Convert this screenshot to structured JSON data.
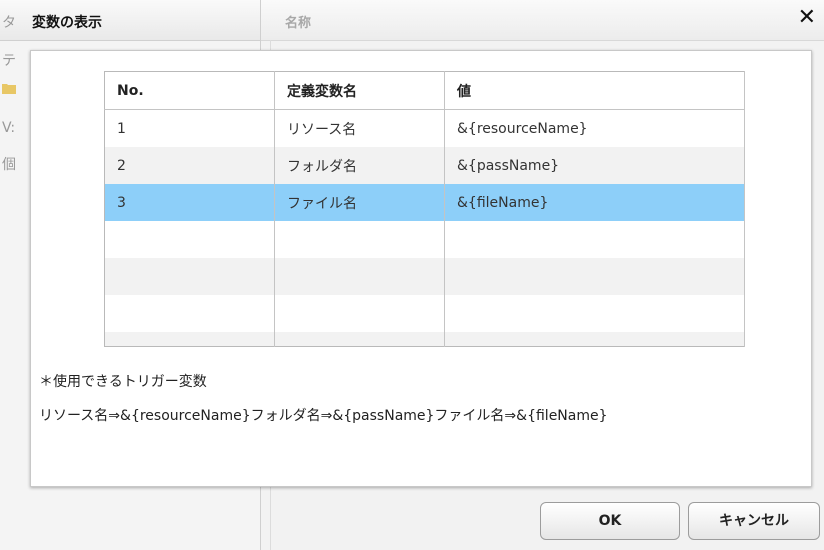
{
  "background": {
    "left_rows": [
      "テ",
      "",
      "V:",
      "個"
    ],
    "left_partial_title": "タ",
    "right_column_header": "名称"
  },
  "dialog": {
    "title": "変数の表示",
    "close_glyph": "✕",
    "table": {
      "headers": [
        "No.",
        "定義変数名",
        "値"
      ],
      "rows": [
        {
          "no": "1",
          "name": "リソース名",
          "value": "&{resourceName}"
        },
        {
          "no": "2",
          "name": "フォルダ名",
          "value": "&{passName}"
        },
        {
          "no": "3",
          "name": "ファイル名",
          "value": "&{fileName}"
        }
      ],
      "selected_row": 3,
      "empty_row_count": 4
    },
    "note_heading": "＊使用できるトリガー変数",
    "note_text": "リソース名⇒&{resourceName}フォルダ名⇒&{passName}ファイル名⇒&{fileName}"
  },
  "buttons": {
    "ok": "OK",
    "cancel": "キャンセル"
  },
  "colors": {
    "selected_row": "#8dcff9",
    "folder_icon": "#e8c765"
  }
}
